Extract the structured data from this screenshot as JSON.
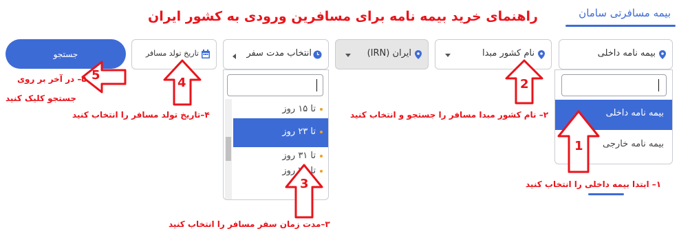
{
  "header": {
    "tab_label": "بیمه مسافرتی سامان",
    "title": "راهنمای خرید بیمه نامه برای مسافرین ورودی به کشور ایران"
  },
  "form": {
    "insurance_type": {
      "selected": "بیمه نامه داخلی",
      "options": [
        "بیمه نامه داخلی",
        "بیمه نامه خارجی"
      ]
    },
    "origin_country": {
      "placeholder": "نام کشور مبدا"
    },
    "destination": {
      "value": "ایران (IRN)"
    },
    "duration": {
      "placeholder": "انتخاب مدت سفر",
      "options": [
        "تا ۱۵ روز",
        "تا ۲۳ روز",
        "تا ۳۱ روز",
        "تا ۴۵ روز"
      ],
      "selected_index": 1
    },
    "birth_date": {
      "placeholder": "تاریخ تولد مسافر"
    },
    "search_button": "جستجو"
  },
  "annotations": {
    "step1_number": "1",
    "step1_text": "۱– ابتدا بیمه داخلی را انتخاب کنید",
    "step2_number": "2",
    "step2_text": "۲– نام کشور مبدا مسافر را جستجو و انتخاب کنید",
    "step3_number": "3",
    "step3_text": "۳–مدت زمان سفر مسافر را انتخاب کنید",
    "step4_number": "4",
    "step4_text": "۴–تاریخ تولد مسافر را انتخاب کنید",
    "step5_number": "5",
    "step5_text_line1": "۵– در آخر بر روی",
    "step5_text_line2": "جستجو کلیک کنید"
  },
  "colors": {
    "accent": "#3d6bd6",
    "annotation": "#e8141b",
    "option_dot": "#f0a020"
  }
}
